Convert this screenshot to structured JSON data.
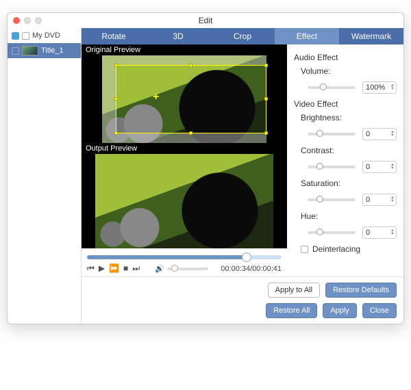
{
  "title": "Edit",
  "sidebar": {
    "root": "My DVD",
    "item": "Title_1"
  },
  "tabs": [
    "Rotate",
    "3D",
    "Crop",
    "Effect",
    "Watermark"
  ],
  "activeTab": "Effect",
  "previews": {
    "original": "Original Preview",
    "output": "Output Preview"
  },
  "playback": {
    "time": "00:00:34/00:00:41"
  },
  "audio": {
    "heading": "Audio Effect",
    "volume_label": "Volume:",
    "volume_value": "100%"
  },
  "video": {
    "heading": "Video Effect",
    "brightness_label": "Brightness:",
    "brightness_value": "0",
    "contrast_label": "Contrast:",
    "contrast_value": "0",
    "saturation_label": "Saturation:",
    "saturation_value": "0",
    "hue_label": "Hue:",
    "hue_value": "0",
    "deinterlacing_label": "Deinterlacing"
  },
  "buttons": {
    "apply_all": "Apply to All",
    "restore_defaults": "Restore Defaults",
    "restore_all": "Restore All",
    "apply": "Apply",
    "close": "Close"
  }
}
